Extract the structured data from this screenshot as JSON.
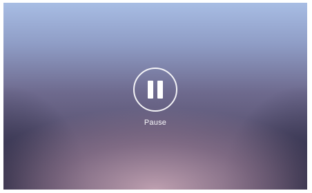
{
  "player": {
    "state": "paused",
    "control": {
      "icon": "pause-icon",
      "label": "Pause"
    }
  },
  "colors": {
    "icon": "#ffffff",
    "top_sky": "#a8bde4",
    "bottom_glow": "#c4a4b4",
    "edge_shadow": "#1e203a"
  }
}
